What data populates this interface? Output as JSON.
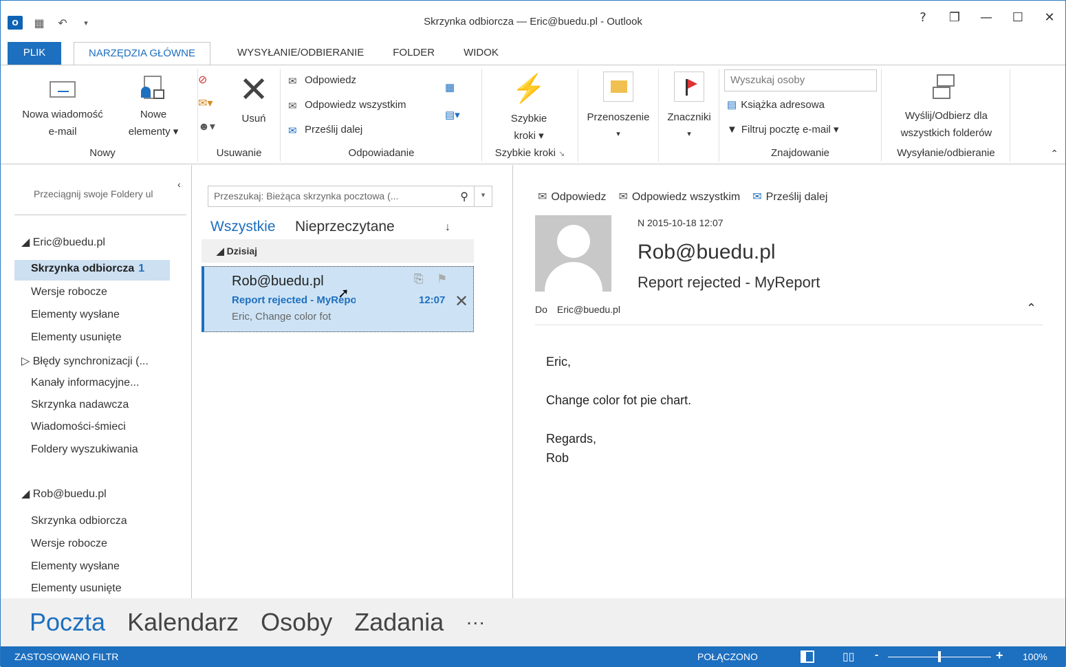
{
  "window": {
    "title": "Skrzynka odbiorcza — Eric@buedu.pl - Outlook",
    "logo": "O↗",
    "controls": [
      "?",
      "❐",
      "—",
      "☐",
      "✕"
    ]
  },
  "tabs": [
    "PLIK",
    "NARZĘDZIA GŁÓWNE",
    "WYSYŁANIE/ODBIERANIE",
    "FOLDER",
    "WIDOK"
  ],
  "ribbon": {
    "nowy": {
      "label": "Nowy",
      "new_email_l1": "Nowa wiadomość",
      "new_email_l2": "e-mail",
      "new_items_l1": "Nowe",
      "new_items_l2": "elementy ▾"
    },
    "usuwanie": {
      "label": "Usuwanie",
      "delete": "Usuń"
    },
    "odpowiadanie": {
      "label": "Odpowiadanie",
      "reply": "Odpowiedz",
      "reply_all": "Odpowiedz wszystkim",
      "forward": "Prześlij dalej"
    },
    "szybkie": {
      "label": "Szybkie kroki",
      "btn_l1": "Szybkie",
      "btn_l2": "kroki ▾"
    },
    "przenoszenie": {
      "btn": "Przenoszenie",
      "arrow": "▾"
    },
    "znaczniki": {
      "btn": "Znaczniki",
      "arrow": "▾"
    },
    "znajdowanie": {
      "label": "Znajdowanie",
      "search_placeholder": "Wyszukaj osoby",
      "address_book": "Książka adresowa",
      "filter": "Filtruj pocztę e-mail ▾"
    },
    "wysylanie": {
      "label": "Wysyłanie/odbieranie",
      "btn_l1": "Wyślij/Odbierz dla",
      "btn_l2": "wszystkich folderów"
    }
  },
  "nav": {
    "hint": "Przeciągnij swoje Foldery ul",
    "account1": "◢ Eric@buedu.pl",
    "account1_items": [
      {
        "label": "Skrzynka odbiorcza",
        "count": "1"
      },
      {
        "label": "Wersje robocze"
      },
      {
        "label": "Elementy wysłane"
      },
      {
        "label": "Elementy usunięte"
      },
      {
        "label": "▷ Błędy synchronizacji (..."
      },
      {
        "label": "Kanały informacyjne..."
      },
      {
        "label": "Skrzynka nadawcza"
      },
      {
        "label": "Wiadomości-śmieci"
      },
      {
        "label": "Foldery wyszukiwania"
      }
    ],
    "account2": "◢ Rob@buedu.pl",
    "account2_items": [
      {
        "label": "Skrzynka odbiorcza"
      },
      {
        "label": "Wersje robocze"
      },
      {
        "label": "Elementy wysłane"
      },
      {
        "label": "Elementy usunięte"
      }
    ]
  },
  "list": {
    "search_placeholder": "Przeszukaj: Bieżąca skrzynka pocztowa (...",
    "filter_all": "Wszystkie",
    "filter_unread": "Nieprzeczytane",
    "sort_icon": "↓",
    "group": "◢  Dzisiaj",
    "mail": {
      "sender": "Rob@buedu.pl",
      "subject": "Report rejected - MyReport",
      "preview": "Eric,  Change color fot",
      "time": "12:07"
    }
  },
  "reading": {
    "reply": "Odpowiedz",
    "reply_all": "Odpowiedz wszystkim",
    "forward": "Prześlij dalej",
    "date": "N 2015-10-18 12:07",
    "from": "Rob@buedu.pl",
    "subject": "Report rejected - MyReport",
    "to_label": "Do",
    "to": "Eric@buedu.pl",
    "body": [
      "Eric,",
      "Change color fot pie chart.",
      "Regards,",
      "Rob"
    ]
  },
  "bottomnav": [
    "Poczta",
    "Kalendarz",
    "Osoby",
    "Zadania",
    "···"
  ],
  "status": {
    "filter": "ZASTOSOWANO FILTR",
    "connected": "POŁĄCZONO",
    "zoom": "100%",
    "zoom_minus": "-",
    "zoom_plus": "+",
    "zoom_level": 0.5
  }
}
